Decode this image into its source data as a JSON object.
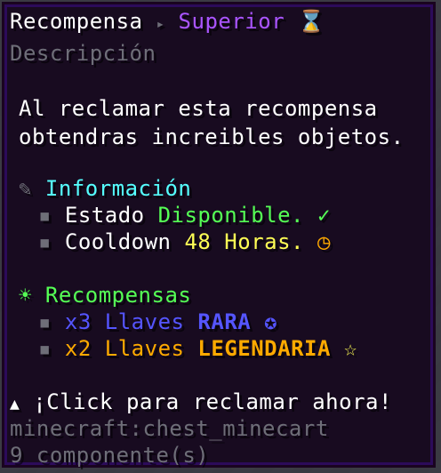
{
  "header": {
    "title": "Recompensa",
    "separator": "▸",
    "rarity": "Superior",
    "rarity_icon": "hourglass-icon",
    "rarity_glyph": "⌛"
  },
  "description_label": "Descripción",
  "description": {
    "line1": "Al reclamar esta recompensa",
    "line2": "obtendras increibles objetos."
  },
  "info": {
    "icon": "pencil-icon",
    "icon_glyph": "✎",
    "title": "Información",
    "items": [
      {
        "label": "Estado",
        "value": "Disponible.",
        "icon": "check-icon",
        "icon_glyph": "✓"
      },
      {
        "label": "Cooldown",
        "value": "48 Horas.",
        "icon": "clock-icon",
        "icon_glyph": "◷"
      }
    ]
  },
  "rewards": {
    "icon": "sparkle-icon",
    "icon_glyph": "☀",
    "title": "Recompensas",
    "items": [
      {
        "qty": "x3",
        "label": "Llaves",
        "tier": "RARA",
        "icon": "star-badge-icon",
        "icon_glyph": "✪"
      },
      {
        "qty": "x2",
        "label": "Llaves",
        "tier": "LEGENDARIA",
        "icon": "star-icon",
        "icon_glyph": "☆"
      }
    ]
  },
  "footer": {
    "cta_icon": "up-arrow-icon",
    "cta_glyph": "▲",
    "cta": "¡Click para reclamar ahora!",
    "item_id": "minecraft:chest_minecart",
    "components": "9 componente(s)"
  },
  "colors": {
    "background": "#16081e",
    "border": "#2c0b5a",
    "aqua": "#55ffff",
    "green": "#55ff55",
    "yellow": "#ffff55",
    "gold": "#ffaa00",
    "blue": "#5555ff",
    "purple": "#aa55ff",
    "gray": "#6e6e78"
  }
}
